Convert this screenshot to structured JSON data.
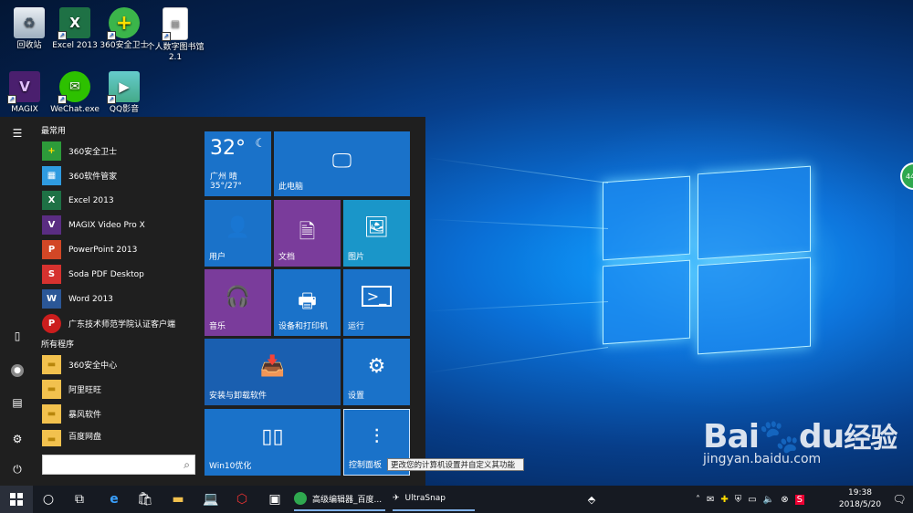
{
  "desktop": {
    "icons": [
      {
        "label": "回收站",
        "icon": "recycle-bin-icon"
      },
      {
        "label": "Excel 2013",
        "icon": "excel-icon"
      },
      {
        "label": "360安全卫士",
        "icon": "360-security-icon"
      },
      {
        "label": "个人数字图书馆2.1",
        "icon": "file-icon"
      },
      {
        "label": "MAGIX",
        "icon": "magix-icon"
      },
      {
        "label": "WeChat.exe",
        "icon": "wechat-icon"
      },
      {
        "label": "QQ影音",
        "icon": "qq-player-icon"
      }
    ],
    "float_button_text": "44"
  },
  "start_menu": {
    "most_used_header": "最常用",
    "all_programs_header": "所有程序",
    "most_used": [
      {
        "label": "360安全卫士",
        "color": "#ffcc00"
      },
      {
        "label": "360软件管家",
        "color": "#2f9be0"
      },
      {
        "label": "Excel 2013",
        "color": "#1e7145"
      },
      {
        "label": "MAGIX Video Pro X",
        "color": "#5a2d82"
      },
      {
        "label": "PowerPoint 2013",
        "color": "#d24726"
      },
      {
        "label": "Soda PDF Desktop",
        "color": "#d6322f"
      },
      {
        "label": "Word 2013",
        "color": "#2b5797"
      },
      {
        "label": "广东技术师范学院认证客户端",
        "color": "#cc1d1d"
      }
    ],
    "all_programs": [
      {
        "label": "360安全中心",
        "color": "#f2c14e"
      },
      {
        "label": "阿里旺旺",
        "color": "#f2c14e"
      },
      {
        "label": "暴风软件",
        "color": "#f2c14e"
      },
      {
        "label": "百度网盘",
        "color": "#f2c14e"
      }
    ],
    "search_placeholder": "",
    "tiles": {
      "weather": {
        "temp": "32°",
        "city": "广州 晴",
        "range": "35°/27°"
      },
      "this_pc": "此电脑",
      "user": "用户",
      "documents": "文档",
      "pictures": "图片",
      "music": "音乐",
      "devices_printers": "设备和打印机",
      "run": "运行",
      "install_uninstall": "安装与卸载软件",
      "settings": "设置",
      "win10_optimize": "Win10优化",
      "control_panel": "控制面板"
    },
    "tooltip": "更改您的计算机设置并自定义其功能",
    "colors": {
      "tile_blue": "#1a72c9",
      "tile_purple": "#7a3c9b",
      "panel_bg": "#1f1f1f"
    }
  },
  "taskbar": {
    "tasks": [
      {
        "label": "高级编辑器_百度..."
      },
      {
        "label": "UltraSnap"
      }
    ],
    "clock_time": "19:38",
    "clock_date": "2018/5/20"
  },
  "watermark": {
    "brand": "Bai",
    "brand2": "du",
    "cn": "经验",
    "url": "jingyan.baidu.com"
  }
}
